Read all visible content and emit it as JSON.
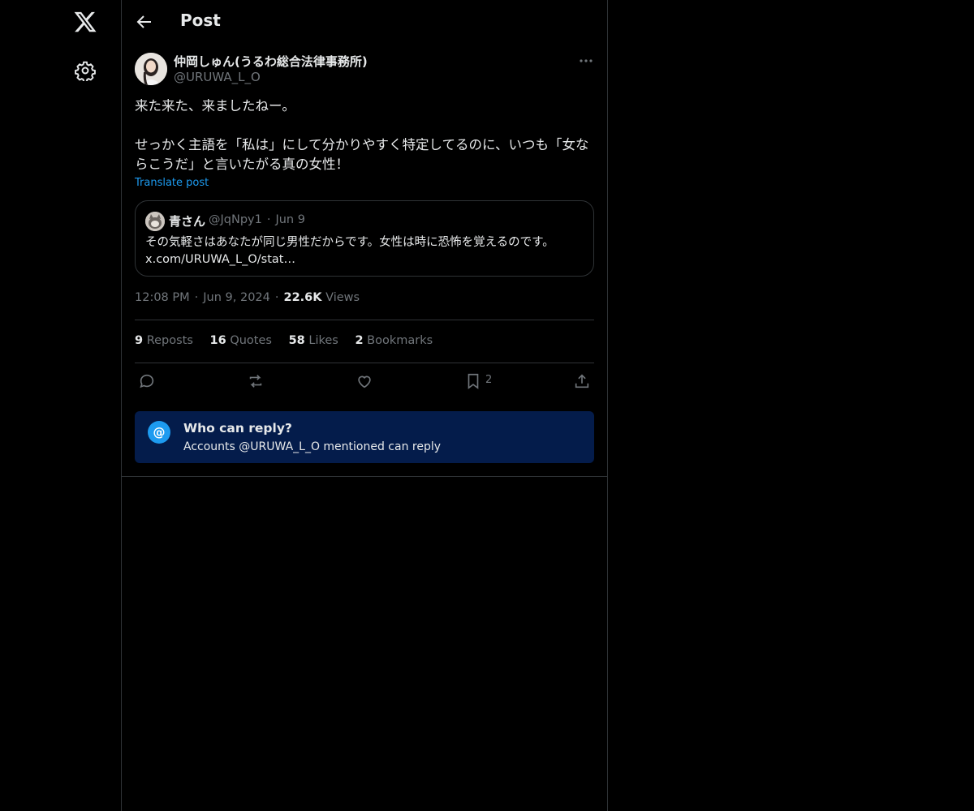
{
  "header": {
    "title": "Post"
  },
  "post": {
    "author_name": "仲岡しゅん(うるわ総合法律事務所)",
    "author_handle": "@URUWA_L_O",
    "text": "来た来た、来ましたねー。\n\nせっかく主語を「私は」にして分かりやすく特定してるのに、いつも「女ならこうだ」と言いたがる真の女性！",
    "translate_label": "Translate post",
    "quote": {
      "name": "青さん",
      "handle": "@JqNpy1",
      "separator": "·",
      "date": "Jun 9",
      "text_line1": "その気軽さはあなたが同じ男性だからです。女性は時に恐怖を覚えるのです。",
      "text_line2": "x.com/URUWA_L_O/stat…"
    },
    "time": "12:08 PM",
    "date": "Jun 9, 2024",
    "separator": "·",
    "views_count": "22.6K",
    "views_label": "Views"
  },
  "stats": {
    "reposts_count": "9",
    "reposts_label": "Reposts",
    "quotes_count": "16",
    "quotes_label": "Quotes",
    "likes_count": "58",
    "likes_label": "Likes",
    "bookmarks_count": "2",
    "bookmarks_label": "Bookmarks"
  },
  "actions": {
    "bookmark_count": "2"
  },
  "reply_restriction": {
    "icon_glyph": "@",
    "title": "Who can reply?",
    "subtitle": "Accounts @URUWA_L_O mentioned can reply"
  },
  "icons": [
    "x-logo-icon",
    "gear-icon",
    "back-arrow-icon",
    "more-icon",
    "reply-icon",
    "repost-icon",
    "like-icon",
    "bookmark-icon",
    "share-icon",
    "at-icon"
  ],
  "colors": {
    "background": "#000000",
    "text": "#e7e9ea",
    "muted": "#71767b",
    "accent": "#1d9bf0",
    "border": "#2f3336",
    "reply_box": "#041c4b"
  }
}
